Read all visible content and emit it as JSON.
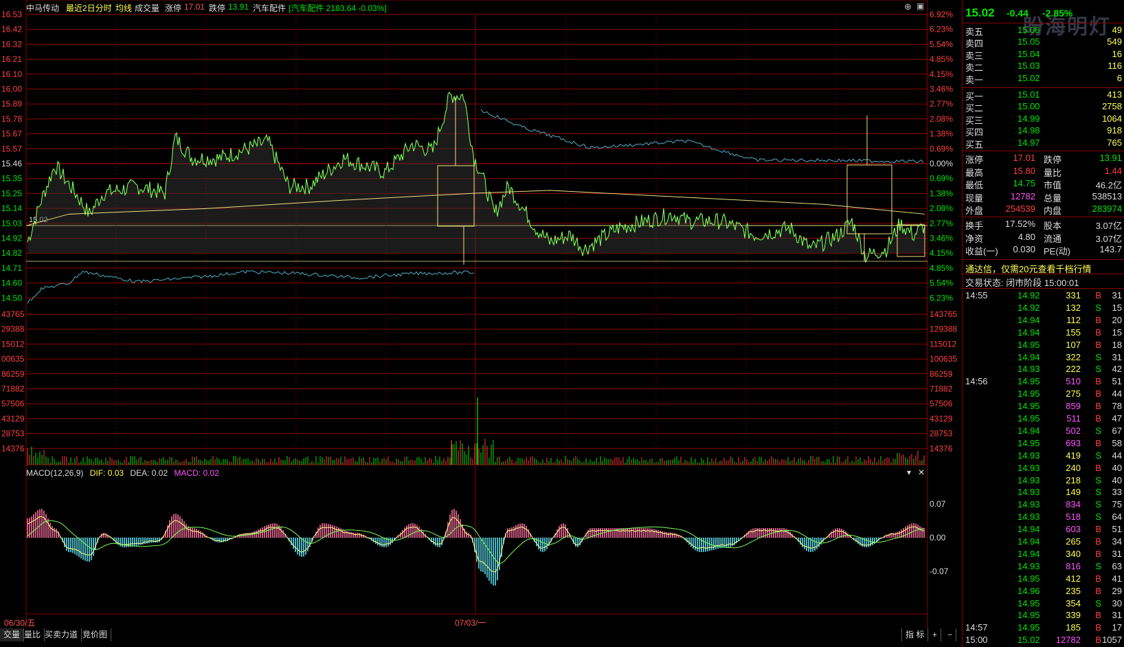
{
  "header": {
    "stock_name": "中马传动",
    "mode": "最近2日分时",
    "avg_line_label": "均线",
    "volume_label": "成交量",
    "limit_up_label": "涨停",
    "limit_up_value": "17.01",
    "limit_down_label": "跌停",
    "limit_down_value": "13.91",
    "sector_name": "汽车配件",
    "sector_quote": "[汽车配件 2183.64 -0.03%]"
  },
  "price_axis": [
    "16.53",
    "16.42",
    "16.32",
    "16.21",
    "16.10",
    "16.00",
    "15.89",
    "15.78",
    "15.67",
    "15.57",
    "15.46",
    "15.35",
    "15.25",
    "15.14",
    "15.03",
    "14.92",
    "14.82",
    "14.71",
    "14.60",
    "14.50"
  ],
  "pct_axis": [
    "6.92%",
    "6.23%",
    "5.54%",
    "4.85%",
    "4.15%",
    "3.46%",
    "2.77%",
    "2.08%",
    "1.38%",
    "0.69%",
    "0.00%",
    "0.69%",
    "1.38%",
    "2.08%",
    "2.77%",
    "3.46%",
    "4.15%",
    "4.85%",
    "5.54%",
    "6.23%"
  ],
  "volume_axis": [
    "143765",
    "129388",
    "115012",
    "100635",
    "86259",
    "71882",
    "57506",
    "43129",
    "28753",
    "14376"
  ],
  "volume_axis_left": [
    "43765",
    "29388",
    "15012",
    "00635",
    "86259",
    "71882",
    "57506",
    "43129",
    "28753",
    "14376"
  ],
  "prev_close_marker": "15.02",
  "macd": {
    "title": "MACD(12,26,9)",
    "dif": "DIF: 0.03",
    "dea": "DEA: 0.02",
    "macd": "MACD: 0.02",
    "axis": [
      "0.07",
      "0.00",
      "-0.07"
    ]
  },
  "dates": {
    "left": "06/30/五",
    "mid": "07/03/一"
  },
  "bottom_tabs": [
    "交量",
    "量比",
    "买卖力道",
    "竞价图"
  ],
  "bottom_right": {
    "indicator": "指 标",
    "plus": "+",
    "minus": "−"
  },
  "colors": {
    "up": "#ff3c3c",
    "down": "#00e600",
    "grid": "#8b0000",
    "price_line": "#7cff5a",
    "avg_line": "#f0e080",
    "accent_yellow": "#ffff55"
  },
  "quote": {
    "price": "15.02",
    "change": "-0.44",
    "change_pct": "-2.85%",
    "asks": [
      {
        "label": "卖五",
        "price": "15.06",
        "vol": "49"
      },
      {
        "label": "卖四",
        "price": "15.05",
        "vol": "549"
      },
      {
        "label": "卖三",
        "price": "15.04",
        "vol": "16"
      },
      {
        "label": "卖二",
        "price": "15.03",
        "vol": "116"
      },
      {
        "label": "卖一",
        "price": "15.02",
        "vol": "6"
      }
    ],
    "bids": [
      {
        "label": "买一",
        "price": "15.01",
        "vol": "413"
      },
      {
        "label": "买二",
        "price": "15.00",
        "vol": "2758"
      },
      {
        "label": "买三",
        "price": "14.99",
        "vol": "1064"
      },
      {
        "label": "买四",
        "price": "14.98",
        "vol": "918"
      },
      {
        "label": "买五",
        "price": "14.97",
        "vol": "765"
      }
    ],
    "stats": [
      {
        "l1": "涨停",
        "v1": "17.01",
        "l2": "跌停",
        "v2": "13.91"
      },
      {
        "l1": "最高",
        "v1": "15.80",
        "l2": "量比",
        "v2": "1.44"
      },
      {
        "l1": "最低",
        "v1": "14.75",
        "l2": "市值",
        "v2": "46.2亿"
      },
      {
        "l1": "现量",
        "v1": "12782",
        "l2": "总量",
        "v2": "538513"
      },
      {
        "l1": "外盘",
        "v1": "254539",
        "l2": "内盘",
        "v2": "283974"
      }
    ],
    "stats2": [
      {
        "l1": "换手",
        "v1": "17.52%",
        "l2": "股本",
        "v2": "3.07亿"
      },
      {
        "l1": "净资",
        "v1": "4.80",
        "l2": "流通",
        "v2": "3.07亿"
      },
      {
        "l1": "收益(一)",
        "v1": "0.030",
        "l2": "PE(动)",
        "v2": "143.7"
      }
    ],
    "promo": "通达信，仅需20元查看千档行情",
    "trade_status": "交易状态: 闭市阶段 15:00:01"
  },
  "ticks": [
    {
      "time": "14:55",
      "price": "14.92",
      "vol": "331",
      "side": "B",
      "n": "31"
    },
    {
      "time": "",
      "price": "14.92",
      "vol": "132",
      "side": "S",
      "n": "15"
    },
    {
      "time": "",
      "price": "14.94",
      "vol": "112",
      "side": "B",
      "n": "20"
    },
    {
      "time": "",
      "price": "14.94",
      "vol": "155",
      "side": "B",
      "n": "15"
    },
    {
      "time": "",
      "price": "14.95",
      "vol": "107",
      "side": "B",
      "n": "18"
    },
    {
      "time": "",
      "price": "14.94",
      "vol": "322",
      "side": "S",
      "n": "31"
    },
    {
      "time": "",
      "price": "14.93",
      "vol": "222",
      "side": "S",
      "n": "42"
    },
    {
      "time": "14:56",
      "price": "14.95",
      "vol": "510",
      "side": "B",
      "n": "51"
    },
    {
      "time": "",
      "price": "14.95",
      "vol": "275",
      "side": "B",
      "n": "44"
    },
    {
      "time": "",
      "price": "14.95",
      "vol": "859",
      "side": "B",
      "n": "78"
    },
    {
      "time": "",
      "price": "14.95",
      "vol": "511",
      "side": "B",
      "n": "47"
    },
    {
      "time": "",
      "price": "14.94",
      "vol": "502",
      "side": "S",
      "n": "67"
    },
    {
      "time": "",
      "price": "14.95",
      "vol": "693",
      "side": "B",
      "n": "58"
    },
    {
      "time": "",
      "price": "14.93",
      "vol": "419",
      "side": "S",
      "n": "44"
    },
    {
      "time": "",
      "price": "14.93",
      "vol": "240",
      "side": "B",
      "n": "40"
    },
    {
      "time": "",
      "price": "14.93",
      "vol": "218",
      "side": "S",
      "n": "40"
    },
    {
      "time": "",
      "price": "14.93",
      "vol": "149",
      "side": "S",
      "n": "33"
    },
    {
      "time": "",
      "price": "14.93",
      "vol": "834",
      "side": "S",
      "n": "75"
    },
    {
      "time": "",
      "price": "14.93",
      "vol": "518",
      "side": "S",
      "n": "64"
    },
    {
      "time": "",
      "price": "14.94",
      "vol": "603",
      "side": "B",
      "n": "51"
    },
    {
      "time": "",
      "price": "14.94",
      "vol": "265",
      "side": "B",
      "n": "34"
    },
    {
      "time": "",
      "price": "14.94",
      "vol": "340",
      "side": "B",
      "n": "31"
    },
    {
      "time": "",
      "price": "14.93",
      "vol": "816",
      "side": "S",
      "n": "63"
    },
    {
      "time": "",
      "price": "14.95",
      "vol": "412",
      "side": "B",
      "n": "41"
    },
    {
      "time": "",
      "price": "14.96",
      "vol": "235",
      "side": "B",
      "n": "29"
    },
    {
      "time": "",
      "price": "14.95",
      "vol": "354",
      "side": "S",
      "n": "30"
    },
    {
      "time": "",
      "price": "14.95",
      "vol": "339",
      "side": "B",
      "n": "31"
    },
    {
      "time": "14:57",
      "price": "14.95",
      "vol": "185",
      "side": "B",
      "n": "17"
    },
    {
      "time": "15:00",
      "price": "15.02",
      "vol": "12782",
      "side": "B",
      "n": "1057"
    }
  ],
  "watermark": "盼海明灯"
}
